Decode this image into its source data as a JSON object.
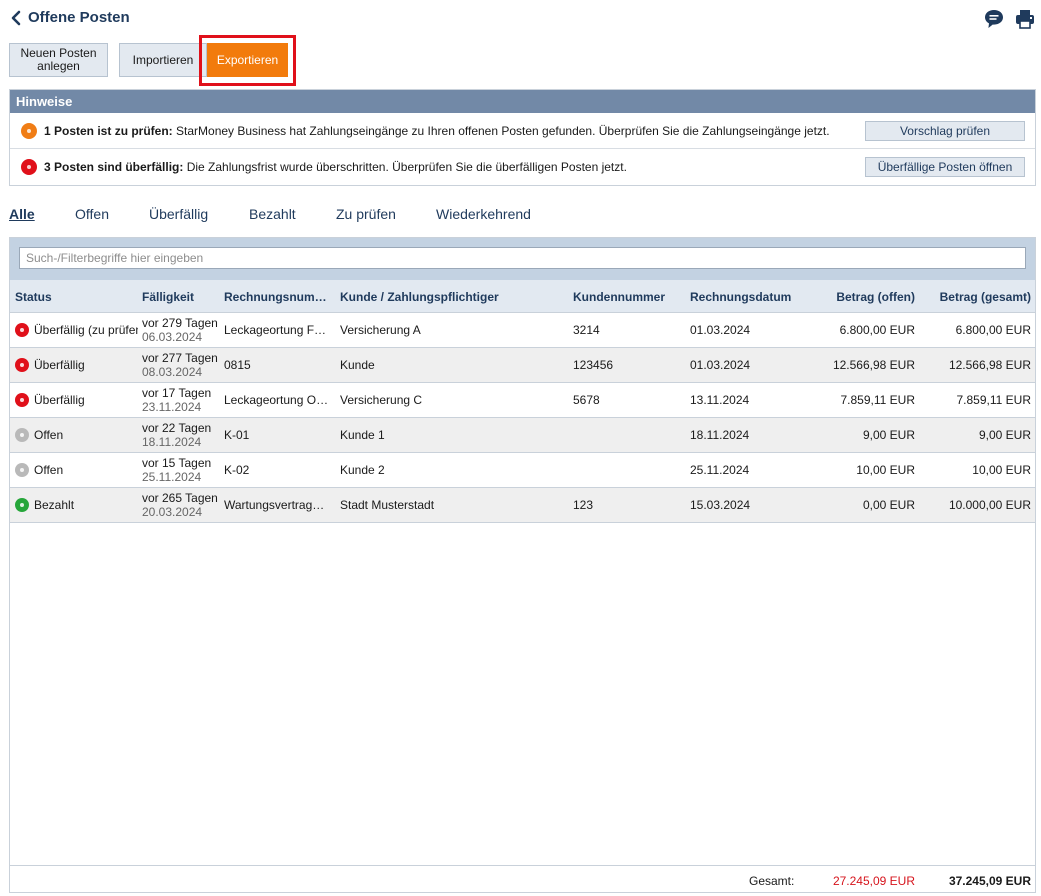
{
  "header": {
    "title": "Offene Posten",
    "back_icon": "chevron-left-icon",
    "comment_icon": "comment-icon",
    "print_icon": "printer-icon"
  },
  "toolbar": {
    "new_label": "Neuen Posten anlegen",
    "import_label": "Importieren",
    "export_label": "Exportieren"
  },
  "hints": {
    "title": "Hinweise",
    "items": [
      {
        "bold": "1 Posten ist zu prüfen:",
        "text": " StarMoney Business hat Zahlungseingänge zu Ihren offenen Posten gefunden. Überprüfen Sie die Zahlungseingänge jetzt.",
        "button": "Vorschlag prüfen",
        "color": "#f07d15"
      },
      {
        "bold": "3 Posten sind überfällig:",
        "text": " Die Zahlungsfrist wurde überschritten. Überprüfen Sie die überfälligen Posten jetzt.",
        "button": "Überfällige Posten öffnen",
        "color": "#e0101a"
      }
    ]
  },
  "tabs": [
    "Alle",
    "Offen",
    "Überfällig",
    "Bezahlt",
    "Zu prüfen",
    "Wiederkehrend"
  ],
  "search": {
    "placeholder": "Such-/Filterbegriffe hier eingeben",
    "value": ""
  },
  "columns": [
    "Status",
    "Fälligkeit",
    "Rechnungsnum…",
    "Kunde / Zahlungspflichtiger",
    "Kundennummer",
    "Rechnungsdatum",
    "Betrag (offen)",
    "Betrag (gesamt)"
  ],
  "rows": [
    {
      "status": "Überfällig (zu prüfen)",
      "status_color": "#e0101a",
      "due_rel": "vor 279 Tagen",
      "due_date": "06.03.2024",
      "invoice": "Leckageortung F…",
      "customer": "Versicherung A",
      "customer_no": "3214",
      "invoice_date": "01.03.2024",
      "open": "6.800,00 EUR",
      "total": "6.800,00 EUR"
    },
    {
      "status": "Überfällig",
      "status_color": "#e0101a",
      "due_rel": "vor 277 Tagen",
      "due_date": "08.03.2024",
      "invoice": "0815",
      "customer": "Kunde",
      "customer_no": "123456",
      "invoice_date": "01.03.2024",
      "open": "12.566,98 EUR",
      "total": "12.566,98 EUR"
    },
    {
      "status": "Überfällig",
      "status_color": "#e0101a",
      "due_rel": "vor 17 Tagen",
      "due_date": "23.11.2024",
      "invoice": "Leckageortung O…",
      "customer": "Versicherung C",
      "customer_no": "5678",
      "invoice_date": "13.11.2024",
      "open": "7.859,11 EUR",
      "total": "7.859,11 EUR"
    },
    {
      "status": "Offen",
      "status_color": "#b9b9b9",
      "due_rel": "vor 22 Tagen",
      "due_date": "18.11.2024",
      "invoice": "K-01",
      "customer": "Kunde 1",
      "customer_no": "",
      "invoice_date": "18.11.2024",
      "open": "9,00 EUR",
      "total": "9,00 EUR"
    },
    {
      "status": "Offen",
      "status_color": "#b9b9b9",
      "due_rel": "vor 15 Tagen",
      "due_date": "25.11.2024",
      "invoice": "K-02",
      "customer": "Kunde 2",
      "customer_no": "",
      "invoice_date": "25.11.2024",
      "open": "10,00 EUR",
      "total": "10,00 EUR"
    },
    {
      "status": "Bezahlt",
      "status_color": "#26a63a",
      "due_rel": "vor 265 Tagen",
      "due_date": "20.03.2024",
      "invoice": "Wartungsvertrag…",
      "customer": "Stadt Musterstadt",
      "customer_no": "123",
      "invoice_date": "15.03.2024",
      "open": "0,00 EUR",
      "total": "10.000,00 EUR"
    }
  ],
  "footer": {
    "label": "Gesamt:",
    "open": "27.245,09 EUR",
    "total": "37.245,09 EUR"
  },
  "colors": {
    "accent": "#f27b0c",
    "highlight": "#e0101a",
    "hints_header": "#7289a7",
    "primary_text": "#1f3a5c"
  }
}
